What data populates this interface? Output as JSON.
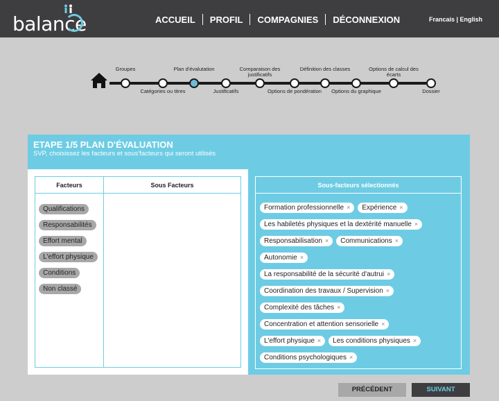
{
  "brand": {
    "name": "balance",
    "accent": "#6fcbe0"
  },
  "nav": {
    "items": [
      "ACCUEIL",
      "PROFIL",
      "COMPAGNIES",
      "DÉCONNEXION"
    ]
  },
  "lang": {
    "text": "Francais | English"
  },
  "stepper": {
    "home_icon": "home-icon",
    "steps": [
      {
        "label": "Groupes"
      },
      {
        "label": "Catégories ou titres"
      },
      {
        "label": "Plan d'évalutation"
      },
      {
        "label": "Justificatifs"
      },
      {
        "label": "Comparaison des justificatifs"
      },
      {
        "label": "Options de pondération"
      },
      {
        "label": "Définition des classes"
      },
      {
        "label": "Options du graphique"
      },
      {
        "label": "Options de calcul des écarts"
      },
      {
        "label": "Dossier"
      }
    ],
    "active_index": 2
  },
  "panel": {
    "title": "ETAPE 1/5 PLAN D'ÉVALUATION",
    "subtitle": "SVP, choisissez les facteurs et sous'facteurs qui seront utilisés",
    "col_facteurs": "Facteurs",
    "col_sous": "Sous Facteurs",
    "factors": [
      "Qualifications",
      "Responsabilités",
      "Effort mental",
      "L'effort physique",
      "Conditions",
      "Non classé"
    ],
    "selected_header": "Sous-facteurs sélectionnés",
    "selected_rows": [
      [
        "Formation professionnelle",
        "Expérience"
      ],
      [
        "Les habiletés physiques et la dextérité manuelle"
      ],
      [
        "Responsabilisation",
        "Communications"
      ],
      [
        "Autonomie"
      ],
      [
        "La responsabilité de la sécurité d'autrui"
      ],
      [
        "Coordination des travaux / Supervision"
      ],
      [
        "Complexité des tâches"
      ],
      [
        "Concentration et attention sensorielle"
      ],
      [
        "L'effort physique",
        "Les conditions physiques"
      ],
      [
        "Conditions psychologiques"
      ]
    ],
    "remove_glyph": "×"
  },
  "buttons": {
    "prev": "PRÉCÉDENT",
    "next": "SUIVANT"
  }
}
